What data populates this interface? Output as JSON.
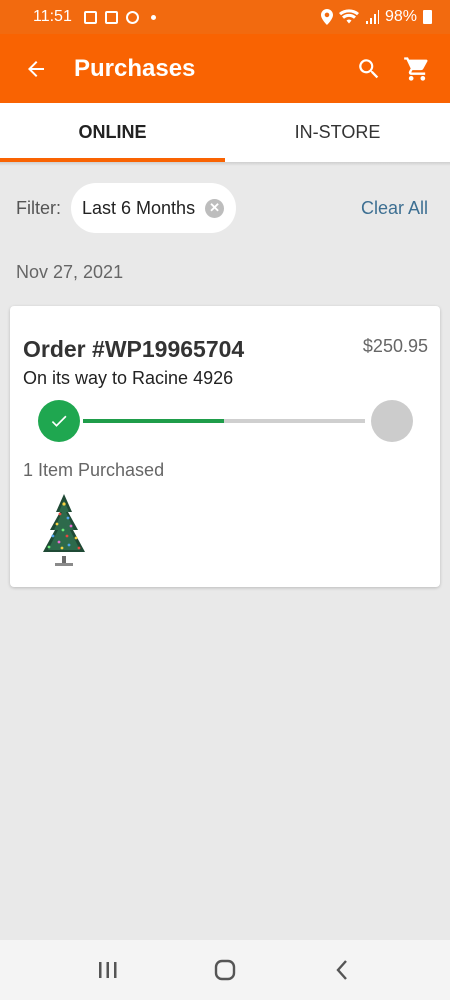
{
  "status_bar": {
    "time": "11:51",
    "battery": "98%"
  },
  "app_bar": {
    "title": "Purchases"
  },
  "tabs": [
    {
      "label": "ONLINE",
      "active": true
    },
    {
      "label": "IN-STORE",
      "active": false
    }
  ],
  "filter": {
    "label": "Filter:",
    "chip": "Last 6 Months",
    "clear_all": "Clear All"
  },
  "order_group": {
    "date": "Nov 27, 2021",
    "order": {
      "number": "Order #WP19965704",
      "total": "$250.95",
      "status": "On its way to Racine 4926",
      "progress": 0.5,
      "items_label": "1 Item Purchased"
    }
  },
  "colors": {
    "brand": "#f96302",
    "status_bar": "#f26a0f",
    "progress": "#1fa750",
    "link": "#3d6f92"
  },
  "icons": {
    "back": "arrow-left-icon",
    "search": "search-icon",
    "cart": "cart-icon",
    "check": "check-icon"
  }
}
